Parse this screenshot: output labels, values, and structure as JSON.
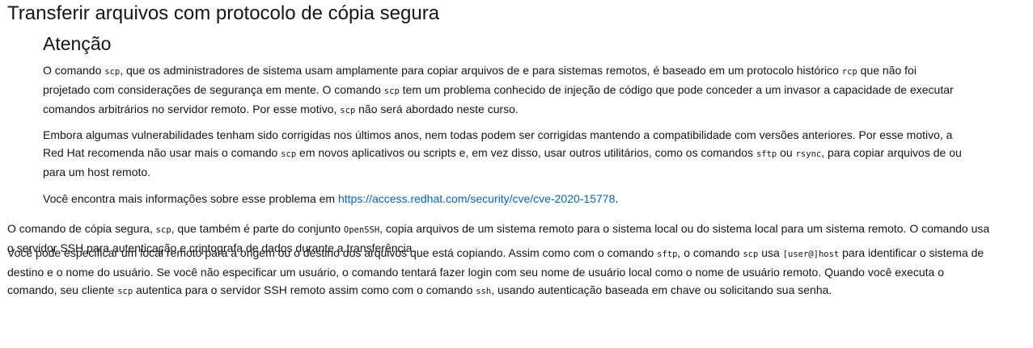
{
  "title": "Transferir arquivos com protocolo de cópia segura",
  "admonition": {
    "heading": "Atenção",
    "p1": {
      "t1": "O comando ",
      "c1": "scp",
      "t2": ", que os administradores de sistema usam amplamente para copiar arquivos de e para sistemas remotos, é baseado em um protocolo histórico ",
      "c2": "rcp",
      "t3": " que não foi",
      "t4": "projetado com considerações de segurança em mente. O comando ",
      "c3": "scp",
      "t5": " tem um problema conhecido de injeção de código que pode conceder a um invasor a capacidade de executar",
      "t6": "comandos arbitrários no servidor remoto. Por esse motivo, ",
      "c4": "scp",
      "t7": " não será abordado neste curso."
    },
    "p2": {
      "t1": "Embora algumas vulnerabilidades tenham sido corrigidas nos últimos anos, nem todas podem ser corrigidas mantendo a compatibilidade com versões anteriores. Por esse motivo, a",
      "t2": "Red Hat recomenda não usar mais o comando ",
      "c1": "scp",
      "t3": " em novos aplicativos ou scripts e, em vez disso, usar outros utilitários, como os comandos ",
      "c2": "sftp",
      "t4": " ou ",
      "c3": "rsync",
      "t5": ", para copiar arquivos de ou",
      "t6": "para um host remoto."
    },
    "p3": {
      "t1": "Você encontra mais informações sobre esse problema em ",
      "link": "https://access.redhat.com/security/cve/cve-2020-15778",
      "t2": "."
    }
  },
  "body_p1": {
    "t1": "O comando de cópia segura, ",
    "c1": "scp",
    "t2": ", que também é parte do conjunto ",
    "c2": "OpenSSH",
    "t3": ", copia arquivos de um sistema remoto para o sistema local ou do sistema local para um sistema remoto. O comando usa",
    "t4": "o servidor SSH para autenticação e criptografa de dados durante a transferência."
  },
  "body_p2": {
    "t1": "Você pode especificar um local remoto para a origem ou o destino dos arquivos que está copiando. Assim como com o comando ",
    "c1": "sftp",
    "t2": ", o comando ",
    "c2": "scp",
    "t3": " usa ",
    "c3": "[user@]host",
    "t4": " para identificar o sistema de",
    "t5": "destino e o nome do usuário. Se você não especificar um usuário, o comando tentará fazer login com seu nome de usuário local como o nome de usuário remoto. Quando você executa o",
    "t6": "comando, seu cliente ",
    "c4": "scp",
    "t7": " autentica para o servidor SSH remoto assim como com o comando ",
    "c5": "ssh",
    "t8": ", usando autenticação baseada em chave ou solicitando sua senha."
  }
}
